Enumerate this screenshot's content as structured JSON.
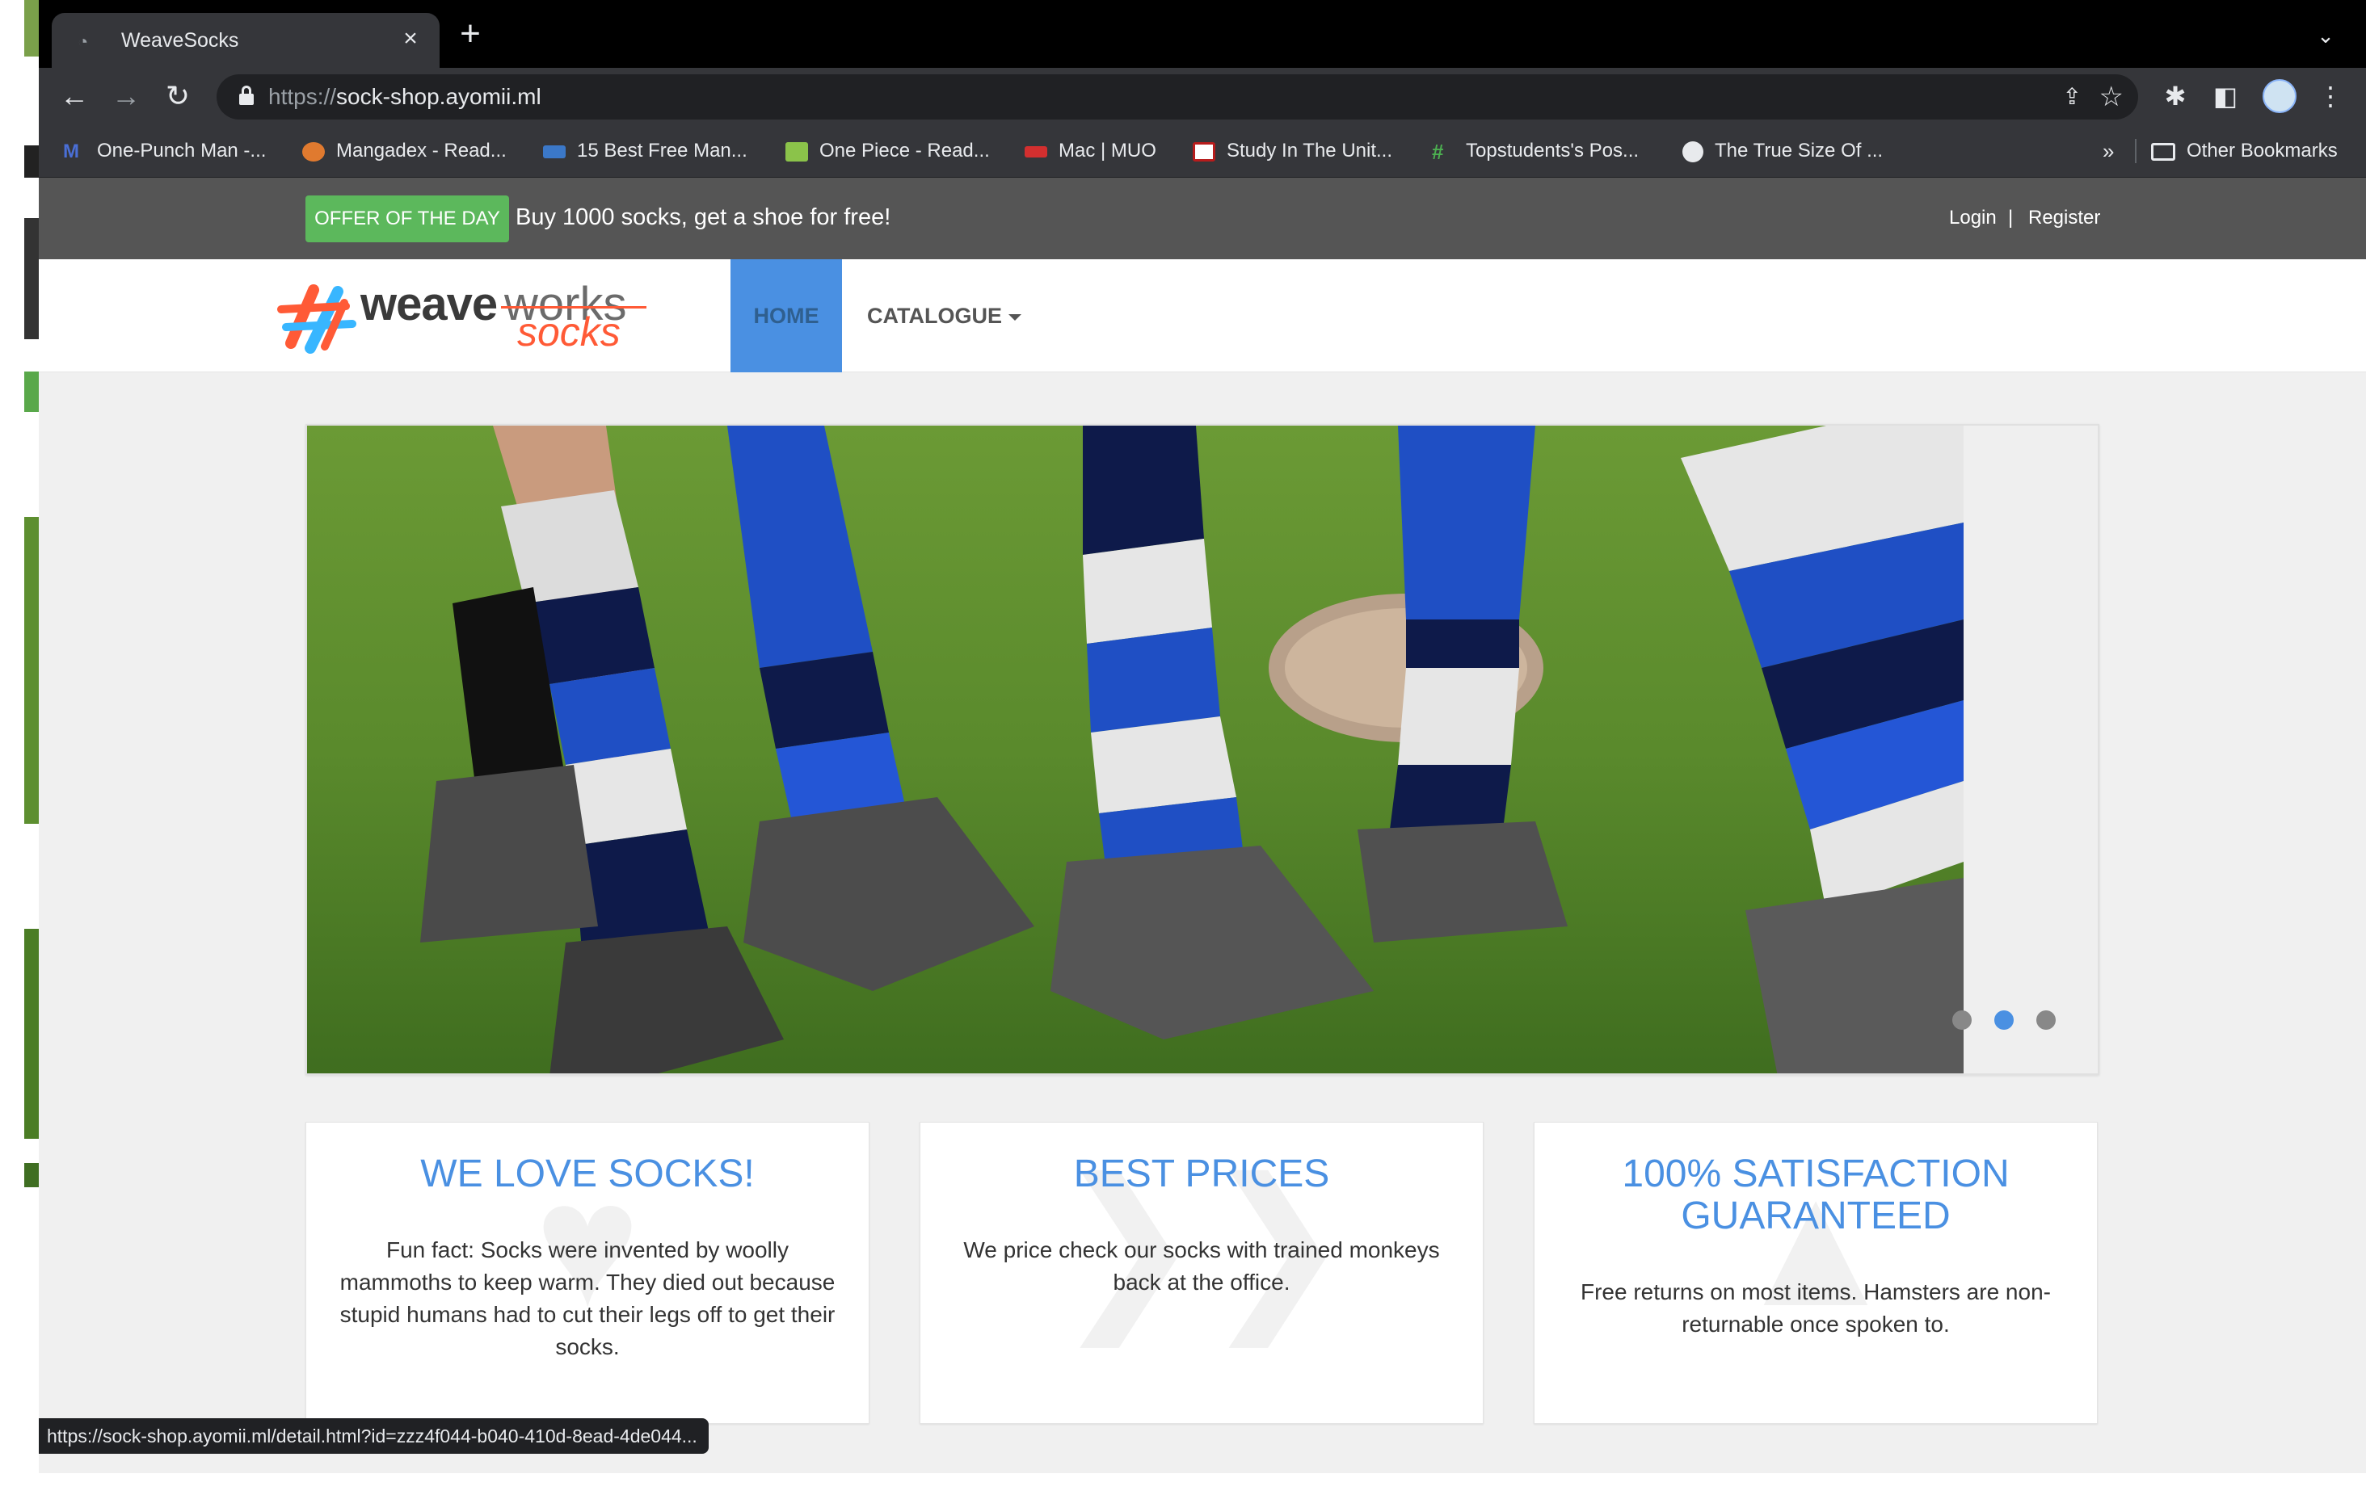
{
  "browser": {
    "tab_title": "WeaveSocks",
    "tab_close": "×",
    "new_tab": "+",
    "tab_menu": "⌄",
    "url_scheme": "https://",
    "url_host": "sock-shop.ayomii.ml",
    "back_glyph": "←",
    "forward_glyph": "→",
    "reload_glyph": "↻",
    "share_glyph": "⇪",
    "star_glyph": "☆",
    "extensions_glyph": "✱",
    "sidepanel_glyph": "◧",
    "menu_glyph": "⋮"
  },
  "bookmarks": {
    "items": [
      {
        "label": "One-Punch Man -...",
        "icon": "manga-icon",
        "color": "#4a6fd6"
      },
      {
        "label": "Mangadex - Read...",
        "icon": "mangadex-icon",
        "color": "#e07a2f"
      },
      {
        "label": "15 Best Free Man...",
        "icon": "mut-icon",
        "color": "#3b78c8"
      },
      {
        "label": "One Piece - Read...",
        "icon": "onepiece-icon",
        "color": "#8bc34a"
      },
      {
        "label": "Mac | MUO",
        "icon": "muo-icon",
        "color": "#d32f2f"
      },
      {
        "label": "Study In The Unit...",
        "icon": "study-icon",
        "color": "#b71c1c"
      },
      {
        "label": "Topstudents's Pos...",
        "icon": "topstudents-icon",
        "color": "#4caf50"
      },
      {
        "label": "The True Size Of ...",
        "icon": "globe-icon",
        "color": "#e8eaed"
      }
    ],
    "more": "»",
    "other_label": "Other Bookmarks"
  },
  "site": {
    "offer_badge": "OFFER OF THE DAY",
    "offer_text": "Buy 1000 socks, get a shoe for free!",
    "login": "Login",
    "login_separator": "|",
    "register": "Register",
    "logo_word_1": "weave",
    "logo_word_2": "works",
    "logo_word_3": "socks",
    "nav_home": "HOME",
    "nav_catalogue": "CATALOGUE",
    "carousel_active_index": 1,
    "carousel_dot_count": 3,
    "colors": {
      "accent": "#4a90e2",
      "offer_green": "#5cb85c",
      "topbar": "#555555"
    }
  },
  "cards": [
    {
      "title": "WE LOVE SOCKS!",
      "body": "Fun fact: Socks were invented by woolly mammoths to keep warm. They died out because stupid humans had to cut their legs off to get their socks.",
      "icon": "heart-icon"
    },
    {
      "title": "BEST PRICES",
      "body": "We price check our socks with trained monkeys back at the office.",
      "icon": "tags-icon"
    },
    {
      "title": "100% SATISFACTION GUARANTEED",
      "body": "Free returns on most items. Hamsters are non-returnable once spoken to.",
      "icon": "thumbs-up-icon"
    }
  ],
  "status_url": "https://sock-shop.ayomii.ml/detail.html?id=zzz4f044-b040-410d-8ead-4de044..."
}
